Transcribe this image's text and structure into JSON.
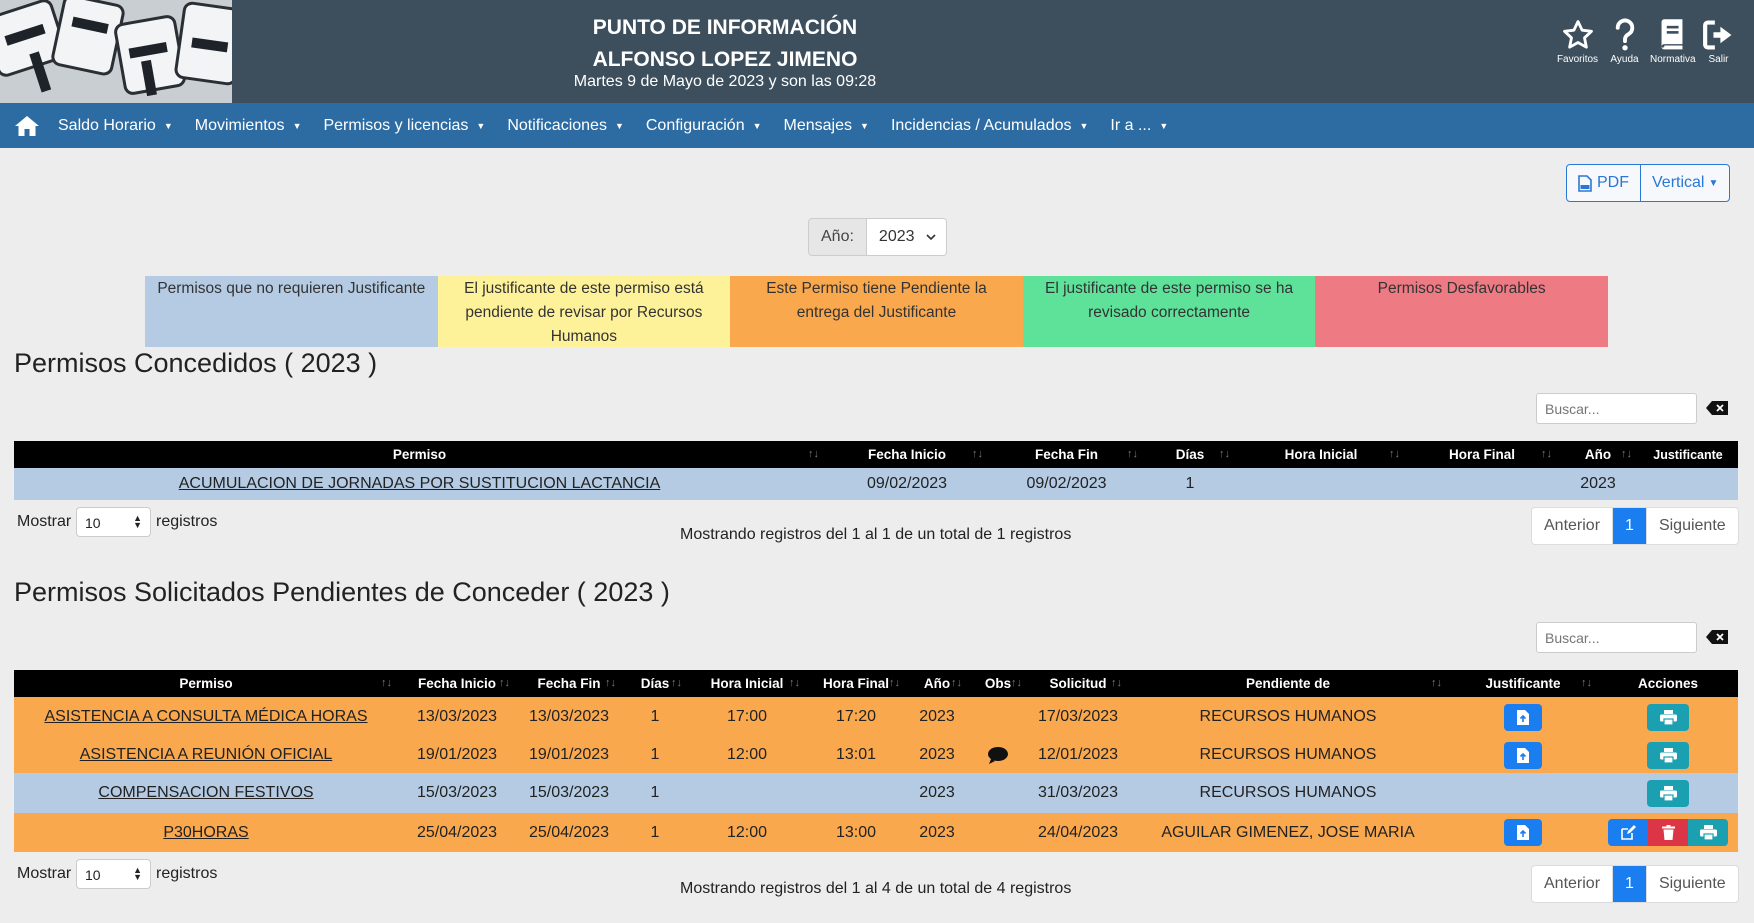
{
  "header": {
    "title_line1": "PUNTO DE INFORMACIÓN",
    "title_line2": "ALFONSO LOPEZ JIMENO",
    "date_line": "Martes 9 de Mayo de 2023 y son las 09:28",
    "icons": [
      {
        "name": "star-icon",
        "label": "Favoritos"
      },
      {
        "name": "question-icon",
        "label": "Ayuda"
      },
      {
        "name": "book-icon",
        "label": "Normativa"
      },
      {
        "name": "exit-icon",
        "label": "Salir"
      }
    ]
  },
  "nav": {
    "items": [
      "Saldo Horario",
      "Movimientos",
      "Permisos y licencias",
      "Notificaciones",
      "Configuración",
      "Mensajes",
      "Incidencias / Acumulados",
      "Ir a ..."
    ]
  },
  "toolbar": {
    "pdf_label": "PDF",
    "orientation_label": "Vertical"
  },
  "year_filter": {
    "label": "Año:",
    "value": "2023"
  },
  "legend": [
    {
      "text": "Permisos que no requieren Justificante",
      "color": "#b4cbe3"
    },
    {
      "text": "El justificante de este permiso está pendiente de revisar por Recursos Humanos",
      "color": "#fdf29a"
    },
    {
      "text": "Este Permiso tiene Pendiente la entrega del Justificante",
      "color": "#f9a84e"
    },
    {
      "text": "El justificante de este permiso se ha revisado correctamente",
      "color": "#5ee29a"
    },
    {
      "text": "Permisos Desfavorables",
      "color": "#ee7b84"
    }
  ],
  "granted": {
    "title": "Permisos Concedidos ( 2023 )",
    "search_placeholder": "Buscar...",
    "columns": [
      "Permiso",
      "Fecha Inicio",
      "Fecha Fin",
      "Días",
      "Hora Inicial",
      "Hora Final",
      "Año",
      "Justificante"
    ],
    "rows": [
      {
        "permiso": "ACUMULACION DE JORNADAS POR SUSTITUCION LACTANCIA",
        "fecha_inicio": "09/02/2023",
        "fecha_fin": "09/02/2023",
        "dias": "1",
        "hora_inicial": "",
        "hora_final": "",
        "anio": "2023",
        "justificante": ""
      }
    ],
    "show_label": "Mostrar",
    "show_value": "10",
    "show_suffix": "registros",
    "info": "Mostrando registros del 1 al 1 de un total de 1 registros",
    "pager": {
      "prev": "Anterior",
      "page": "1",
      "next": "Siguiente"
    }
  },
  "pending": {
    "title": "Permisos Solicitados Pendientes de Conceder ( 2023 )",
    "search_placeholder": "Buscar...",
    "columns": [
      "Permiso",
      "Fecha Inicio",
      "Fecha Fin",
      "Días",
      "Hora Inicial",
      "Hora Final",
      "Año",
      "Obs",
      "Solicitud",
      "Pendiente de",
      "Justificante",
      "Acciones"
    ],
    "rows": [
      {
        "permiso": "ASISTENCIA A CONSULTA MÉDICA HORAS",
        "fecha_inicio": "13/03/2023",
        "fecha_fin": "13/03/2023",
        "dias": "1",
        "hora_inicial": "17:00",
        "hora_final": "17:20",
        "anio": "2023",
        "solicitud": "17/03/2023",
        "pendiente": "RECURSOS HUMANOS"
      },
      {
        "permiso": "ASISTENCIA A REUNIÓN OFICIAL",
        "fecha_inicio": "19/01/2023",
        "fecha_fin": "19/01/2023",
        "dias": "1",
        "hora_inicial": "12:00",
        "hora_final": "13:01",
        "anio": "2023",
        "solicitud": "12/01/2023",
        "pendiente": "RECURSOS HUMANOS"
      },
      {
        "permiso": "COMPENSACION FESTIVOS",
        "fecha_inicio": "15/03/2023",
        "fecha_fin": "15/03/2023",
        "dias": "1",
        "hora_inicial": "",
        "hora_final": "",
        "anio": "2023",
        "solicitud": "31/03/2023",
        "pendiente": "RECURSOS HUMANOS"
      },
      {
        "permiso": "P30HORAS",
        "fecha_inicio": "25/04/2023",
        "fecha_fin": "25/04/2023",
        "dias": "1",
        "hora_inicial": "12:00",
        "hora_final": "13:00",
        "anio": "2023",
        "solicitud": "24/04/2023",
        "pendiente": "AGUILAR GIMENEZ, JOSE MARIA"
      }
    ],
    "show_label": "Mostrar",
    "show_value": "10",
    "show_suffix": "registros",
    "info": "Mostrando registros del 1 al 4 de un total de 4 registros",
    "pager": {
      "prev": "Anterior",
      "page": "1",
      "next": "Siguiente"
    }
  }
}
